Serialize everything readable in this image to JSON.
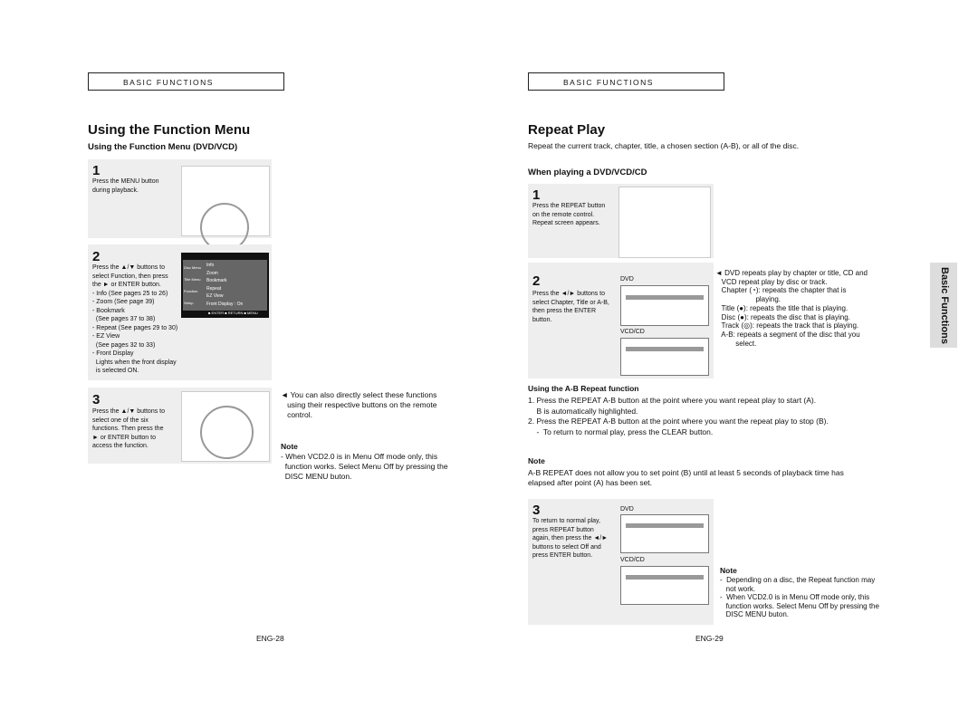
{
  "left": {
    "header": "BASIC FUNCTIONS",
    "title": "Using the Function Menu",
    "subtitle": "Using the Function Menu (DVD/VCD)",
    "step1": {
      "num": "1",
      "lines": [
        "Press the MENU button",
        "during playback."
      ]
    },
    "step2": {
      "num": "2",
      "lines": [
        "Press the ▲/▼ buttons to",
        "select Function, then press",
        "the ► or ENTER button.",
        "- Info (See pages 25 to 26)",
        "- Zoom (See page 39)",
        "- Bookmark",
        "  (See pages 37 to 38)",
        "- Repeat (See pages 29 to 30)",
        "- EZ View",
        "  (See pages 32 to 33)",
        "- Front Display",
        "  Lights when the front display",
        "  is selected ON."
      ],
      "menu": {
        "items": [
          "Info",
          "Zoom",
          "Bookmark",
          "Repeat",
          "EZ View",
          "Front Display : On"
        ],
        "tabs": [
          "Disc Menu",
          "Title Menu",
          "Function",
          "Setup"
        ],
        "footer": "■ ENTER  ■ RETURN  ■ MENU"
      }
    },
    "step3": {
      "num": "3",
      "lines": [
        "Press the ▲/▼ buttons to",
        "select one of the six",
        "functions. Then press the",
        "► or ENTER button to",
        "access the function."
      ]
    },
    "tip": [
      "◄ You can also directly select these functions",
      "   using their respective buttons on the remote",
      "   control."
    ],
    "note_title": "Note",
    "note": [
      "- When VCD2.0 is in Menu Off mode only, this",
      "  function works. Select Menu Off by pressing the",
      "  DISC MENU buton."
    ],
    "page": "ENG-28"
  },
  "right": {
    "header": "BASIC FUNCTIONS",
    "title": "Repeat Play",
    "desc": "Repeat the current track, chapter, title, a chosen section (A-B), or all of the disc.",
    "subtitle": "When playing a DVD/VCD/CD",
    "step1": {
      "num": "1",
      "lines": [
        "Press the REPEAT button",
        "on the remote control.",
        "Repeat screen appears."
      ]
    },
    "step2": {
      "num": "2",
      "lines": [
        "Press the ◄/► buttons to",
        "select Chapter, Title or A-B,",
        "then press the ENTER",
        "button."
      ],
      "dvd": "DVD",
      "vcd": "VCD/CD"
    },
    "side": [
      "◄ DVD repeats play by chapter or title, CD and",
      "   VCD repeat play by disc or track.",
      "   Chapter (◔): repeats the chapter that is",
      "                    playing.",
      "   Title (●): repeats the title that is playing.",
      "   Disc (●): repeats the disc that is playing.",
      "   Track (◎): repeats the track that is playing.",
      "   A-B: repeats a segment of the disc that you",
      "          select."
    ],
    "tab": "Basic Functions",
    "ab_title": "Using the A-B Repeat function",
    "ab": [
      "1. Press the REPEAT A-B button at the point where you want repeat play to start (A).",
      "    B is automatically highlighted.",
      "2. Press the REPEAT A-B button at the point where you want the repeat play to stop (B).",
      "    -  To return to normal play, press the CLEAR button."
    ],
    "note_title": "Note",
    "note": [
      "A-B REPEAT does not allow you to set point (B) until at least 5 seconds of playback time has",
      "elapsed after point (A) has been set."
    ],
    "step3": {
      "num": "3",
      "lines": [
        "To return to normal play,",
        "press REPEAT button",
        "again, then press the ◄/►",
        "buttons to select Off and",
        "press ENTER button."
      ],
      "dvd": "DVD",
      "vcd": "VCD/CD"
    },
    "note2_title": "Note",
    "note2": [
      "-  Depending on a disc, the Repeat function may",
      "   not work.",
      "-  When VCD2.0 is in Menu Off mode only, this",
      "   function works. Select Menu Off by pressing the",
      "   DISC MENU buton."
    ],
    "page": "ENG-29"
  }
}
